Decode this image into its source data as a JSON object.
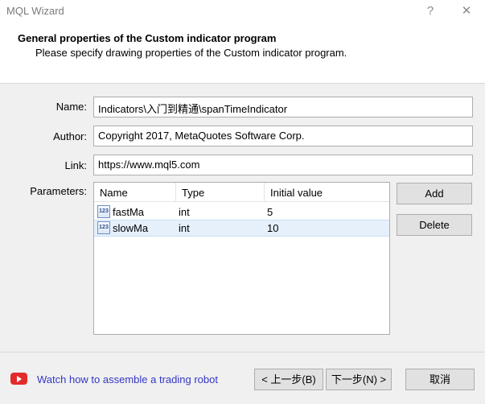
{
  "window": {
    "title": "MQL Wizard",
    "help_symbol": "?",
    "close_symbol": "✕"
  },
  "header": {
    "title": "General properties of the Custom indicator program",
    "subtitle": "Please specify drawing properties of the Custom indicator program."
  },
  "form": {
    "name_label": "Name:",
    "name_value": "Indicators\\入门到精通\\spanTimeIndicator",
    "author_label": "Author:",
    "author_value": "Copyright 2017, MetaQuotes Software Corp.",
    "link_label": "Link:",
    "link_value": "https://www.mql5.com",
    "parameters_label": "Parameters:"
  },
  "parameters": {
    "columns": [
      "Name",
      "Type",
      "Initial value"
    ],
    "rows": [
      {
        "icon": "123",
        "name": "fastMa",
        "type": "int",
        "value": "5"
      },
      {
        "icon": "123",
        "name": "slowMa",
        "type": "int",
        "value": "10"
      }
    ]
  },
  "side_buttons": {
    "add": "Add",
    "delete": "Delete"
  },
  "footer": {
    "video_link": "Watch how to assemble a trading robot",
    "back": "< 上一步(B)",
    "next": "下一步(N) >",
    "cancel": "取消"
  }
}
